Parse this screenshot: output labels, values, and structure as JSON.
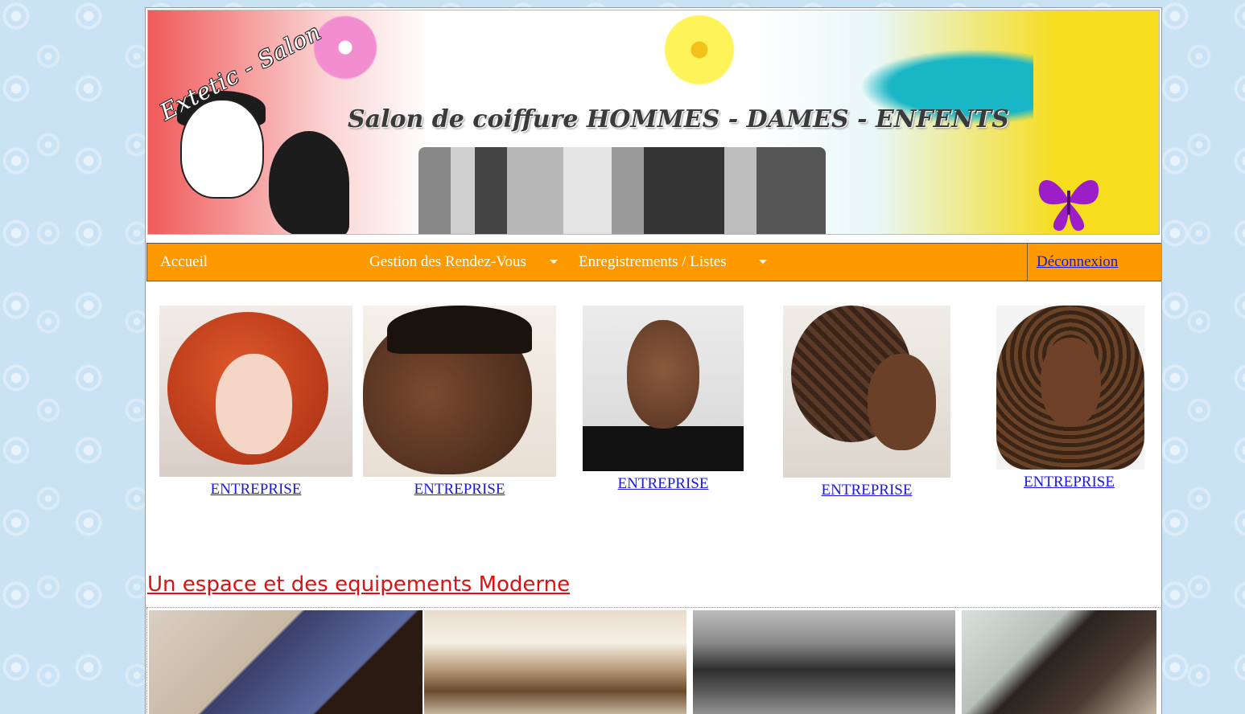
{
  "banner": {
    "logo_text": "Extetic - Salon",
    "title": "Salon de coiffure HOMMES - DAMES - ENFENTS"
  },
  "nav": {
    "home": "Accueil",
    "appointments": "Gestion des Rendez-Vous",
    "records": "Enregistrements / Listes",
    "logout": "Déconnexion"
  },
  "gallery": [
    {
      "label": "ENTREPRISE",
      "subject": "woman-red-curly-hair"
    },
    {
      "label": "ENTREPRISE",
      "subject": "man-short-haircut-profile"
    },
    {
      "label": "ENTREPRISE",
      "subject": "man-portrait"
    },
    {
      "label": "ENTREPRISE",
      "subject": "woman-braided-hair"
    },
    {
      "label": "ENTREPRISE",
      "subject": "woman-long-curly-hair"
    }
  ],
  "section": {
    "title": "Un espace et des equipements Moderne"
  },
  "colors": {
    "nav_bg": "#fe9900",
    "link": "#1a1ad8",
    "section_title": "#e01010",
    "page_bg": "#c9e2f4"
  }
}
